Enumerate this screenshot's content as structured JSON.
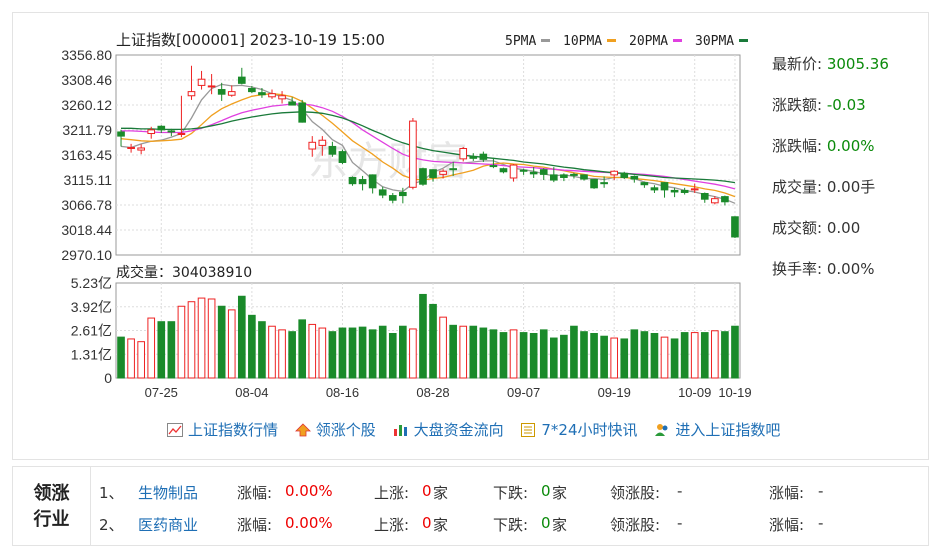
{
  "chart_data": [
    {
      "type": "candlestick",
      "title": "上证指数[000001] 2023-10-19 15:00",
      "legend": [
        {
          "name": "5PMA",
          "color": "#999999"
        },
        {
          "name": "10PMA",
          "color": "#f0a020"
        },
        {
          "name": "20PMA",
          "color": "#e040e0"
        },
        {
          "name": "30PMA",
          "color": "#1a7a3a"
        }
      ],
      "y_ticks": [
        "3356.80",
        "3308.46",
        "3260.12",
        "3211.79",
        "3163.45",
        "3115.11",
        "3066.78",
        "3018.44",
        "2970.10"
      ],
      "ylim": [
        2970.1,
        3356.8
      ],
      "x_ticks": [
        "07-25",
        "08-04",
        "08-16",
        "08-28",
        "09-07",
        "09-19",
        "10-09",
        "10-19"
      ],
      "candles": [
        [
          3208,
          3200,
          3180,
          3212,
          "d"
        ],
        [
          3176,
          3178,
          3168,
          3185,
          "u"
        ],
        [
          3173,
          3177,
          3165,
          3184,
          "u"
        ],
        [
          3205,
          3212,
          3195,
          3218,
          "u"
        ],
        [
          3212,
          3219,
          3206,
          3221,
          "d"
        ],
        [
          3209,
          3210,
          3200,
          3214,
          "d"
        ],
        [
          3204,
          3205,
          3198,
          3278,
          "u"
        ],
        [
          3278,
          3286,
          3270,
          3336,
          "u"
        ],
        [
          3298,
          3310,
          3290,
          3326,
          "u"
        ],
        [
          3296,
          3297,
          3281,
          3320,
          "u"
        ],
        [
          3281,
          3290,
          3268,
          3303,
          "d"
        ],
        [
          3286,
          3279,
          3276,
          3298,
          "u"
        ],
        [
          3314,
          3302,
          3300,
          3332,
          "d"
        ],
        [
          3292,
          3286,
          3283,
          3297,
          "d"
        ],
        [
          3284,
          3280,
          3274,
          3293,
          "d"
        ],
        [
          3282,
          3276,
          3272,
          3290,
          "u"
        ],
        [
          3272,
          3278,
          3263,
          3287,
          "u"
        ],
        [
          3260,
          3266,
          3262,
          3275,
          "d"
        ],
        [
          3264,
          3227,
          3226,
          3270,
          "d"
        ],
        [
          3175,
          3188,
          3160,
          3200,
          "u"
        ],
        [
          3182,
          3192,
          3162,
          3200,
          "u"
        ],
        [
          3180,
          3165,
          3160,
          3189,
          "d"
        ],
        [
          3170,
          3149,
          3146,
          3174,
          "d"
        ],
        [
          3120,
          3108,
          3104,
          3122,
          "d"
        ],
        [
          3116,
          3108,
          3095,
          3123,
          "d"
        ],
        [
          3125,
          3100,
          3089,
          3126,
          "d"
        ],
        [
          3096,
          3086,
          3080,
          3102,
          "d"
        ],
        [
          3085,
          3076,
          3070,
          3090,
          "d"
        ],
        [
          3091,
          3085,
          3070,
          3100,
          "d"
        ],
        [
          3101,
          3229,
          3097,
          3235,
          "u"
        ],
        [
          3137,
          3107,
          3104,
          3139,
          "d"
        ],
        [
          3135,
          3120,
          3112,
          3136,
          "d"
        ],
        [
          3126,
          3132,
          3118,
          3136,
          "u"
        ],
        [
          3136,
          3137,
          3123,
          3150,
          "d"
        ],
        [
          3156,
          3176,
          3151,
          3179,
          "u"
        ],
        [
          3160,
          3157,
          3152,
          3167,
          "d"
        ],
        [
          3165,
          3155,
          3150,
          3170,
          "d"
        ],
        [
          3143,
          3143,
          3138,
          3158,
          "d"
        ],
        [
          3137,
          3131,
          3128,
          3139,
          "d"
        ],
        [
          3119,
          3144,
          3112,
          3146,
          "u"
        ],
        [
          3132,
          3134,
          3125,
          3137,
          "d"
        ],
        [
          3130,
          3127,
          3119,
          3140,
          "d"
        ],
        [
          3135,
          3126,
          3115,
          3138,
          "d"
        ],
        [
          3125,
          3115,
          3111,
          3140,
          "d"
        ],
        [
          3125,
          3120,
          3113,
          3128,
          "d"
        ],
        [
          3126,
          3124,
          3118,
          3129,
          "d"
        ],
        [
          3125,
          3117,
          3114,
          3126,
          "d"
        ],
        [
          3116,
          3100,
          3098,
          3117,
          "d"
        ],
        [
          3108,
          3110,
          3100,
          3122,
          "d"
        ],
        [
          3125,
          3132,
          3115,
          3134,
          "u"
        ],
        [
          3128,
          3120,
          3117,
          3131,
          "d"
        ],
        [
          3122,
          3117,
          3110,
          3124,
          "d"
        ],
        [
          3110,
          3106,
          3100,
          3112,
          "d"
        ],
        [
          3100,
          3096,
          3090,
          3105,
          "d"
        ],
        [
          3096,
          3110,
          3081,
          3111,
          "d"
        ],
        [
          3092,
          3095,
          3082,
          3100,
          "d"
        ],
        [
          3095,
          3091,
          3087,
          3100,
          "d"
        ],
        [
          3096,
          3098,
          3090,
          3108,
          "u"
        ],
        [
          3089,
          3078,
          3071,
          3091,
          "d"
        ],
        [
          3071,
          3079,
          3068,
          3084,
          "u"
        ],
        [
          3083,
          3073,
          3066,
          3085,
          "d"
        ],
        [
          3044,
          3005,
          3003,
          3045,
          "d"
        ]
      ],
      "ma5": [
        3180,
        3178,
        3185,
        3190,
        3192,
        3198,
        3205,
        3235,
        3270,
        3292,
        3300,
        3297,
        3298,
        3295,
        3290,
        3282,
        3276,
        3269,
        3252,
        3228,
        3213,
        3193,
        3182,
        3149,
        3133,
        3116,
        3102,
        3096,
        3093,
        3108,
        3114,
        3130,
        3138,
        3150,
        3148,
        3150,
        3152,
        3152,
        3145,
        3138,
        3135,
        3132,
        3127,
        3123,
        3125,
        3122,
        3118,
        3118,
        3116,
        3120,
        3120,
        3118,
        3111,
        3108,
        3103,
        3100,
        3095,
        3092,
        3087,
        3083,
        3078,
        3070
      ],
      "ma10": [
        3195,
        3193,
        3191,
        3190,
        3191,
        3192,
        3194,
        3205,
        3222,
        3240,
        3253,
        3262,
        3270,
        3277,
        3280,
        3282,
        3280,
        3276,
        3267,
        3254,
        3240,
        3225,
        3208,
        3191,
        3178,
        3165,
        3150,
        3138,
        3124,
        3117,
        3115,
        3118,
        3120,
        3125,
        3129,
        3134,
        3142,
        3146,
        3148,
        3146,
        3145,
        3142,
        3140,
        3136,
        3133,
        3129,
        3126,
        3122,
        3121,
        3120,
        3120,
        3118,
        3116,
        3114,
        3111,
        3108,
        3105,
        3102,
        3098,
        3095,
        3090,
        3083
      ],
      "ma20": [
        3210,
        3210,
        3209,
        3208,
        3207,
        3207,
        3207,
        3210,
        3215,
        3222,
        3230,
        3238,
        3245,
        3250,
        3254,
        3258,
        3260,
        3262,
        3262,
        3260,
        3255,
        3248,
        3238,
        3226,
        3212,
        3200,
        3188,
        3176,
        3165,
        3158,
        3154,
        3151,
        3150,
        3149,
        3148,
        3147,
        3146,
        3145,
        3143,
        3141,
        3140,
        3139,
        3137,
        3136,
        3134,
        3133,
        3132,
        3131,
        3130,
        3129,
        3128,
        3127,
        3126,
        3124,
        3122,
        3119,
        3116,
        3113,
        3110,
        3107,
        3103,
        3098
      ],
      "ma30": [
        3215,
        3215,
        3214,
        3214,
        3213,
        3213,
        3213,
        3214,
        3216,
        3220,
        3224,
        3229,
        3233,
        3237,
        3240,
        3243,
        3245,
        3246,
        3247,
        3246,
        3244,
        3240,
        3235,
        3228,
        3220,
        3211,
        3203,
        3194,
        3187,
        3181,
        3176,
        3172,
        3169,
        3166,
        3163,
        3161,
        3159,
        3157,
        3155,
        3153,
        3150,
        3148,
        3146,
        3143,
        3140,
        3138,
        3135,
        3133,
        3131,
        3129,
        3128,
        3126,
        3124,
        3122,
        3120,
        3119,
        3118,
        3117,
        3116,
        3115,
        3113,
        3110
      ]
    },
    {
      "type": "bar",
      "title": "成交量：304038910",
      "y_ticks": [
        "5.23亿",
        "3.92亿",
        "2.61亿",
        "1.31亿",
        "0"
      ],
      "ylim": [
        0,
        5.23
      ],
      "values": [
        2.25,
        2.15,
        2.0,
        3.3,
        3.1,
        3.1,
        3.95,
        4.2,
        4.4,
        4.35,
        3.95,
        3.75,
        4.5,
        3.45,
        3.1,
        2.85,
        2.65,
        2.55,
        3.2,
        2.95,
        2.75,
        2.55,
        2.75,
        2.75,
        2.8,
        2.65,
        2.85,
        2.45,
        2.85,
        2.7,
        4.6,
        4.05,
        3.35,
        2.9,
        2.85,
        2.85,
        2.75,
        2.65,
        2.5,
        2.65,
        2.5,
        2.45,
        2.65,
        2.2,
        2.35,
        2.85,
        2.55,
        2.45,
        2.3,
        2.2,
        2.15,
        2.65,
        2.55,
        2.45,
        2.25,
        2.15,
        2.5,
        2.5,
        2.5,
        2.6,
        2.55,
        2.85
      ],
      "up": [
        "d",
        "u",
        "u",
        "u",
        "d",
        "d",
        "u",
        "u",
        "u",
        "u",
        "d",
        "u",
        "d",
        "d",
        "d",
        "u",
        "u",
        "d",
        "d",
        "u",
        "u",
        "d",
        "d",
        "d",
        "d",
        "d",
        "d",
        "d",
        "d",
        "u",
        "d",
        "d",
        "u",
        "d",
        "u",
        "d",
        "d",
        "d",
        "d",
        "u",
        "d",
        "d",
        "d",
        "d",
        "d",
        "d",
        "d",
        "d",
        "d",
        "u",
        "d",
        "d",
        "d",
        "d",
        "u",
        "d",
        "d",
        "u",
        "d",
        "u",
        "d",
        "d"
      ]
    }
  ],
  "watermark": "东方财富",
  "stats": [
    {
      "label": "最新价:",
      "value": "3005.36"
    },
    {
      "label": "涨跌额:",
      "value": "-0.03"
    },
    {
      "label": "涨跌幅:",
      "value": "0.00%"
    },
    {
      "label": "成交量:",
      "value": "0.00手"
    },
    {
      "label": "成交额:",
      "value": "0.00"
    },
    {
      "label": "换手率:",
      "value": "0.00%"
    }
  ],
  "links": [
    {
      "label": "上证指数行情",
      "icon": "chart-icon"
    },
    {
      "label": "领涨个股",
      "icon": "up-arrow-icon"
    },
    {
      "label": "大盘资金流向",
      "icon": "bars-icon"
    },
    {
      "label": "7*24小时快讯",
      "icon": "news-icon"
    },
    {
      "label": "进入上证指数吧",
      "icon": "users-icon"
    }
  ],
  "sector": {
    "title_line1": "领涨",
    "title_line2": "行业",
    "rows": [
      {
        "idx": "1、",
        "name": "生物制品",
        "change_label": "涨幅:",
        "change": "0.00%",
        "up_label": "上涨:",
        "up": "0",
        "up_unit": "家",
        "down_label": "下跌:",
        "down": "0",
        "down_unit": "家",
        "lead_label": "领涨股:",
        "lead": "-",
        "lead_change_label": "涨幅:",
        "lead_change": "-"
      },
      {
        "idx": "2、",
        "name": "医药商业",
        "change_label": "涨幅:",
        "change": "0.00%",
        "up_label": "上涨:",
        "up": "0",
        "up_unit": "家",
        "down_label": "下跌:",
        "down": "0",
        "down_unit": "家",
        "lead_label": "领涨股:",
        "lead": "-",
        "lead_change_label": "涨幅:",
        "lead_change": "-"
      }
    ]
  }
}
